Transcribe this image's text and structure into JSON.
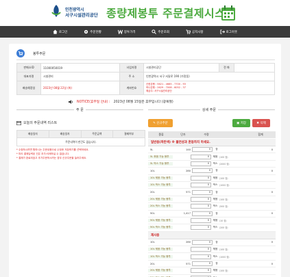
{
  "header": {
    "org_line1": "인천광역시",
    "org_line2": "서구시설관리공단",
    "system_title": "종량제봉투 주문결제시스템"
  },
  "nav": [
    {
      "label": "로그인",
      "icon": "home-icon"
    },
    {
      "label": "주문현황",
      "icon": "gear-icon"
    },
    {
      "label": "봉투가격",
      "icon": "won-icon"
    },
    {
      "label": "주문조회",
      "icon": "search-icon"
    },
    {
      "label": "공지사항",
      "icon": "cart-icon"
    },
    {
      "label": "로그아웃",
      "icon": "logout-icon"
    }
  ],
  "page": {
    "title": "봉투주문"
  },
  "info": {
    "row1": {
      "label_a": "판매소ID",
      "value_a": "11000050019",
      "label_b": "사업자명",
      "value_b": "시설관리공단",
      "label_c": "전 화",
      "value_c": ""
    },
    "row2": {
      "label_a": "대표자명",
      "value_a": "시설관리",
      "label_b": "주 소",
      "value_b": "인천광역시 서구 서달로 190 (가정동)"
    },
    "row3": {
      "label_a": "배송예정일",
      "value_a": "2023년 08월 22일 (화)",
      "label_b": "계좌번호",
      "value_b1": "신한은행 : 5621 - 4685 - 7700 - 93",
      "value_b2": "하나은행 : 2629 - 7008 - 6052 - 37",
      "value_b3": "예금주: 서구시설관리공단"
    }
  },
  "notice": {
    "label": "NOTICE(휴무일 안내) :",
    "text": "2023년 08월 15일은 휴무입니다 (광복절)"
  },
  "sections": {
    "left": "주 문",
    "right": "상세 주문"
  },
  "left_list": {
    "title": "오늘의 주문내역 리스트",
    "columns": [
      "배송일자",
      "배송일자",
      "주문금액",
      "결제여부"
    ],
    "empty": "주문내역이 한건도 없습니다.",
    "notes": [
      "* 수정하시려면 원하시는 주문내용으로 수정후 저장하기를 선택하세요.",
      "* 미리 결제입력된 건은 추가/삭제하실 수 없습니다.",
      "* 결제가 완료되었고 추가주문하시려는 경우 신규주문을 눌러주세요."
    ]
  },
  "buttons": {
    "new_order": "신규주문",
    "save": "저장",
    "delete": "삭제"
  },
  "right_table": {
    "columns": [
      "종류",
      "단가",
      "수량",
      "",
      "합계"
    ],
    "categories": [
      {
        "title": "일반용(파란색) ※ 불연성과 혼동하지 마세요.",
        "rows": [
          {
            "name": "5L",
            "price": "140",
            "qty": "0",
            "unit": "장",
            "extra": "",
            "total": "0"
          },
          {
            "name": "5L 묶음 가능 봉투",
            "sub": true,
            "price": "",
            "qty": "0",
            "unit": "묶음",
            "extra": "(100 장)",
            "total": ""
          },
          {
            "name": "5L 박스 가능 봉투",
            "sub": true,
            "price": "",
            "qty": "0",
            "unit": "박스",
            "extra": "(2000 장)",
            "total": ""
          },
          {
            "name": "10L",
            "price": "280",
            "qty": "0",
            "unit": "장",
            "extra": "",
            "total": "0"
          },
          {
            "name": "10L 묶음 가능 봉투",
            "sub": true,
            "price": "",
            "qty": "0",
            "unit": "묶음",
            "extra": "(100 장)",
            "total": ""
          },
          {
            "name": "10L 박스 가능 봉투",
            "sub": true,
            "price": "",
            "qty": "0",
            "unit": "박스",
            "extra": "(1000 장)",
            "total": ""
          },
          {
            "name": "20L",
            "price": "571",
            "qty": "0",
            "unit": "장",
            "extra": "",
            "total": "0"
          },
          {
            "name": "20L 묶음 가능 봉투",
            "sub": true,
            "price": "",
            "qty": "0",
            "unit": "묶음",
            "extra": "(100 장)",
            "total": ""
          },
          {
            "name": "20L 박스 가능 봉투",
            "sub": true,
            "price": "",
            "qty": "0",
            "unit": "박스",
            "extra": "(500 장)",
            "total": ""
          },
          {
            "name": "50L",
            "price": "1,417",
            "qty": "0",
            "unit": "장",
            "extra": "",
            "total": "0"
          },
          {
            "name": "50L 묶음 가능 봉투",
            "sub": true,
            "price": "",
            "qty": "0",
            "unit": "묶음",
            "extra": "(10 장)",
            "total": ""
          },
          {
            "name": "50L 박스 가능 봉투",
            "sub": true,
            "price": "",
            "qty": "0",
            "unit": "박스",
            "extra": "(200 장)",
            "total": ""
          }
        ]
      },
      {
        "title": "재사용",
        "rows": [
          {
            "name": "10L",
            "price": "280",
            "qty": "0",
            "unit": "장",
            "extra": "",
            "total": "0"
          },
          {
            "name": "10L 묶음 가능 봉투",
            "sub": true,
            "price": "",
            "qty": "0",
            "unit": "묶음",
            "extra": "(100 장)",
            "total": ""
          },
          {
            "name": "10L 박스 가능 봉투",
            "sub": true,
            "price": "",
            "qty": "0",
            "unit": "박스",
            "extra": "(1000 장)",
            "total": ""
          },
          {
            "name": "20L",
            "price": "571",
            "qty": "0",
            "unit": "장",
            "extra": "",
            "total": "0"
          },
          {
            "name": "20L 묶음 가능 봉투",
            "sub": true,
            "price": "",
            "qty": "0",
            "unit": "묶음",
            "extra": "(100 장)",
            "total": ""
          },
          {
            "name": "20L 박스 가능 봉투",
            "sub": true,
            "price": "",
            "qty": "0",
            "unit": "박스",
            "extra": "(500 장)",
            "total": ""
          }
        ]
      }
    ]
  }
}
